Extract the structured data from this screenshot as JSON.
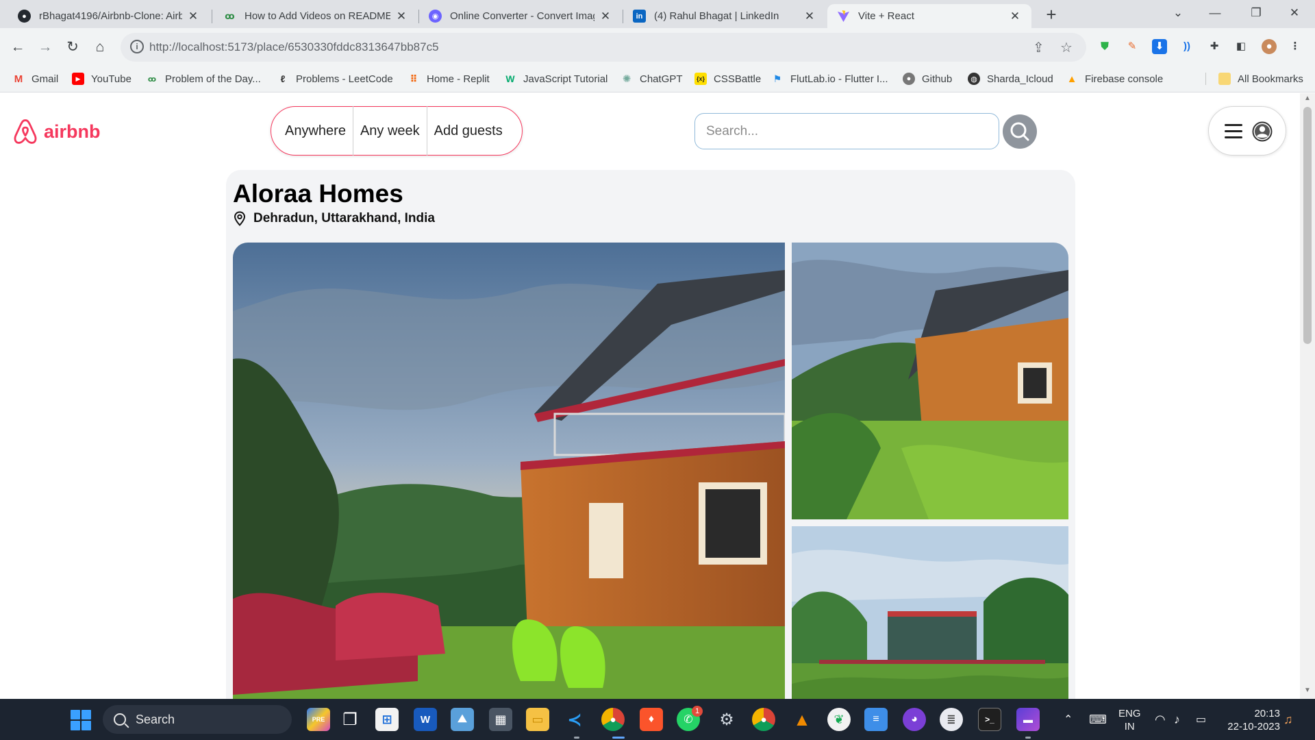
{
  "browser": {
    "tabs": [
      {
        "title": "rBhagat4196/Airbnb-Clone: Airb",
        "icon": "github-icon",
        "active": false
      },
      {
        "title": "How to Add Videos on README",
        "icon": "geeksforgeeks-icon",
        "active": false
      },
      {
        "title": "Online Converter - Convert Imag",
        "icon": "converter-icon",
        "active": false
      },
      {
        "title": "(4) Rahul Bhagat | LinkedIn",
        "icon": "linkedin-icon",
        "active": false
      },
      {
        "title": "Vite + React",
        "icon": "vite-icon",
        "active": true
      }
    ],
    "url": "http://localhost:5173/place/6530330fddc8313647bb87c5",
    "bookmarks": [
      {
        "label": "Gmail",
        "icon": "gmail-icon"
      },
      {
        "label": "YouTube",
        "icon": "youtube-icon"
      },
      {
        "label": "Problem of the Day...",
        "icon": "geeksforgeeks-icon"
      },
      {
        "label": "Problems - LeetCode",
        "icon": "leetcode-icon"
      },
      {
        "label": "Home - Replit",
        "icon": "replit-icon"
      },
      {
        "label": "JavaScript Tutorial",
        "icon": "w3schools-icon"
      },
      {
        "label": "ChatGPT",
        "icon": "chatgpt-icon"
      },
      {
        "label": "CSSBattle",
        "icon": "cssbattle-icon"
      },
      {
        "label": "FlutLab.io - Flutter I...",
        "icon": "flutlab-icon"
      },
      {
        "label": "Github",
        "icon": "github-icon"
      },
      {
        "label": "Sharda_Icloud",
        "icon": "globe-icon"
      },
      {
        "label": "Firebase console",
        "icon": "firebase-icon"
      }
    ],
    "all_bookmarks": "All Bookmarks"
  },
  "site": {
    "logo_text": "airbnb",
    "search_pill": {
      "anywhere": "Anywhere",
      "any_week": "Any week",
      "add_guests": "Add guests"
    },
    "search_placeholder": "Search...",
    "accent_color": "#f5385d"
  },
  "place": {
    "title": "Aloraa Homes",
    "location": "Dehradun, Uttarakhand, India"
  },
  "taskbar": {
    "search_label": "Search",
    "language": "ENG",
    "region": "IN",
    "time": "20:13",
    "date": "22-10-2023",
    "whatsapp_badge": "1"
  }
}
